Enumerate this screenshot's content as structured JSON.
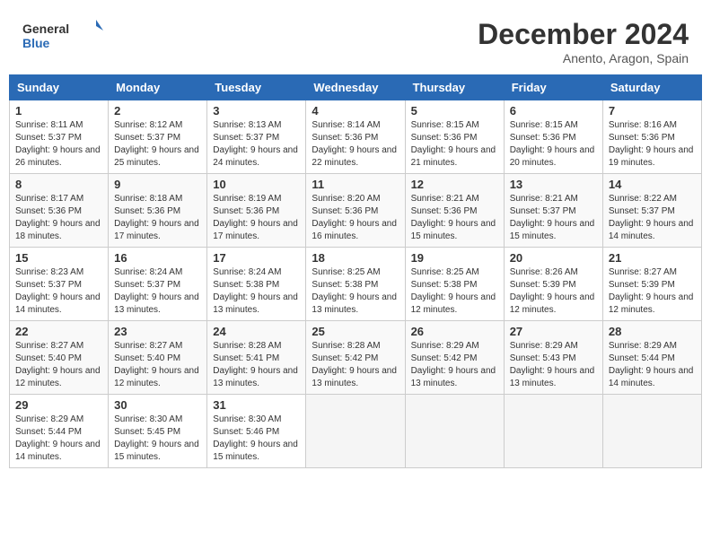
{
  "header": {
    "logo_general": "General",
    "logo_blue": "Blue",
    "month_title": "December 2024",
    "location": "Anento, Aragon, Spain"
  },
  "calendar": {
    "days_of_week": [
      "Sunday",
      "Monday",
      "Tuesday",
      "Wednesday",
      "Thursday",
      "Friday",
      "Saturday"
    ],
    "weeks": [
      [
        null,
        {
          "day": 2,
          "sunrise": "Sunrise: 8:12 AM",
          "sunset": "Sunset: 5:37 PM",
          "daylight": "Daylight: 9 hours and 25 minutes."
        },
        {
          "day": 3,
          "sunrise": "Sunrise: 8:13 AM",
          "sunset": "Sunset: 5:37 PM",
          "daylight": "Daylight: 9 hours and 24 minutes."
        },
        {
          "day": 4,
          "sunrise": "Sunrise: 8:14 AM",
          "sunset": "Sunset: 5:36 PM",
          "daylight": "Daylight: 9 hours and 22 minutes."
        },
        {
          "day": 5,
          "sunrise": "Sunrise: 8:15 AM",
          "sunset": "Sunset: 5:36 PM",
          "daylight": "Daylight: 9 hours and 21 minutes."
        },
        {
          "day": 6,
          "sunrise": "Sunrise: 8:15 AM",
          "sunset": "Sunset: 5:36 PM",
          "daylight": "Daylight: 9 hours and 20 minutes."
        },
        {
          "day": 7,
          "sunrise": "Sunrise: 8:16 AM",
          "sunset": "Sunset: 5:36 PM",
          "daylight": "Daylight: 9 hours and 19 minutes."
        }
      ],
      [
        {
          "day": 1,
          "sunrise": "Sunrise: 8:11 AM",
          "sunset": "Sunset: 5:37 PM",
          "daylight": "Daylight: 9 hours and 26 minutes."
        },
        {
          "day": 9,
          "sunrise": "Sunrise: 8:18 AM",
          "sunset": "Sunset: 5:36 PM",
          "daylight": "Daylight: 9 hours and 17 minutes."
        },
        {
          "day": 10,
          "sunrise": "Sunrise: 8:19 AM",
          "sunset": "Sunset: 5:36 PM",
          "daylight": "Daylight: 9 hours and 17 minutes."
        },
        {
          "day": 11,
          "sunrise": "Sunrise: 8:20 AM",
          "sunset": "Sunset: 5:36 PM",
          "daylight": "Daylight: 9 hours and 16 minutes."
        },
        {
          "day": 12,
          "sunrise": "Sunrise: 8:21 AM",
          "sunset": "Sunset: 5:36 PM",
          "daylight": "Daylight: 9 hours and 15 minutes."
        },
        {
          "day": 13,
          "sunrise": "Sunrise: 8:21 AM",
          "sunset": "Sunset: 5:37 PM",
          "daylight": "Daylight: 9 hours and 15 minutes."
        },
        {
          "day": 14,
          "sunrise": "Sunrise: 8:22 AM",
          "sunset": "Sunset: 5:37 PM",
          "daylight": "Daylight: 9 hours and 14 minutes."
        }
      ],
      [
        {
          "day": 8,
          "sunrise": "Sunrise: 8:17 AM",
          "sunset": "Sunset: 5:36 PM",
          "daylight": "Daylight: 9 hours and 18 minutes."
        },
        {
          "day": 16,
          "sunrise": "Sunrise: 8:24 AM",
          "sunset": "Sunset: 5:37 PM",
          "daylight": "Daylight: 9 hours and 13 minutes."
        },
        {
          "day": 17,
          "sunrise": "Sunrise: 8:24 AM",
          "sunset": "Sunset: 5:38 PM",
          "daylight": "Daylight: 9 hours and 13 minutes."
        },
        {
          "day": 18,
          "sunrise": "Sunrise: 8:25 AM",
          "sunset": "Sunset: 5:38 PM",
          "daylight": "Daylight: 9 hours and 13 minutes."
        },
        {
          "day": 19,
          "sunrise": "Sunrise: 8:25 AM",
          "sunset": "Sunset: 5:38 PM",
          "daylight": "Daylight: 9 hours and 12 minutes."
        },
        {
          "day": 20,
          "sunrise": "Sunrise: 8:26 AM",
          "sunset": "Sunset: 5:39 PM",
          "daylight": "Daylight: 9 hours and 12 minutes."
        },
        {
          "day": 21,
          "sunrise": "Sunrise: 8:27 AM",
          "sunset": "Sunset: 5:39 PM",
          "daylight": "Daylight: 9 hours and 12 minutes."
        }
      ],
      [
        {
          "day": 15,
          "sunrise": "Sunrise: 8:23 AM",
          "sunset": "Sunset: 5:37 PM",
          "daylight": "Daylight: 9 hours and 14 minutes."
        },
        {
          "day": 23,
          "sunrise": "Sunrise: 8:27 AM",
          "sunset": "Sunset: 5:40 PM",
          "daylight": "Daylight: 9 hours and 12 minutes."
        },
        {
          "day": 24,
          "sunrise": "Sunrise: 8:28 AM",
          "sunset": "Sunset: 5:41 PM",
          "daylight": "Daylight: 9 hours and 13 minutes."
        },
        {
          "day": 25,
          "sunrise": "Sunrise: 8:28 AM",
          "sunset": "Sunset: 5:42 PM",
          "daylight": "Daylight: 9 hours and 13 minutes."
        },
        {
          "day": 26,
          "sunrise": "Sunrise: 8:29 AM",
          "sunset": "Sunset: 5:42 PM",
          "daylight": "Daylight: 9 hours and 13 minutes."
        },
        {
          "day": 27,
          "sunrise": "Sunrise: 8:29 AM",
          "sunset": "Sunset: 5:43 PM",
          "daylight": "Daylight: 9 hours and 13 minutes."
        },
        {
          "day": 28,
          "sunrise": "Sunrise: 8:29 AM",
          "sunset": "Sunset: 5:44 PM",
          "daylight": "Daylight: 9 hours and 14 minutes."
        }
      ],
      [
        {
          "day": 22,
          "sunrise": "Sunrise: 8:27 AM",
          "sunset": "Sunset: 5:40 PM",
          "daylight": "Daylight: 9 hours and 12 minutes."
        },
        {
          "day": 30,
          "sunrise": "Sunrise: 8:30 AM",
          "sunset": "Sunset: 5:45 PM",
          "daylight": "Daylight: 9 hours and 15 minutes."
        },
        {
          "day": 31,
          "sunrise": "Sunrise: 8:30 AM",
          "sunset": "Sunset: 5:46 PM",
          "daylight": "Daylight: 9 hours and 15 minutes."
        },
        null,
        null,
        null,
        null
      ],
      [
        {
          "day": 29,
          "sunrise": "Sunrise: 8:29 AM",
          "sunset": "Sunset: 5:44 PM",
          "daylight": "Daylight: 9 hours and 14 minutes."
        },
        null,
        null,
        null,
        null,
        null,
        null
      ]
    ]
  }
}
